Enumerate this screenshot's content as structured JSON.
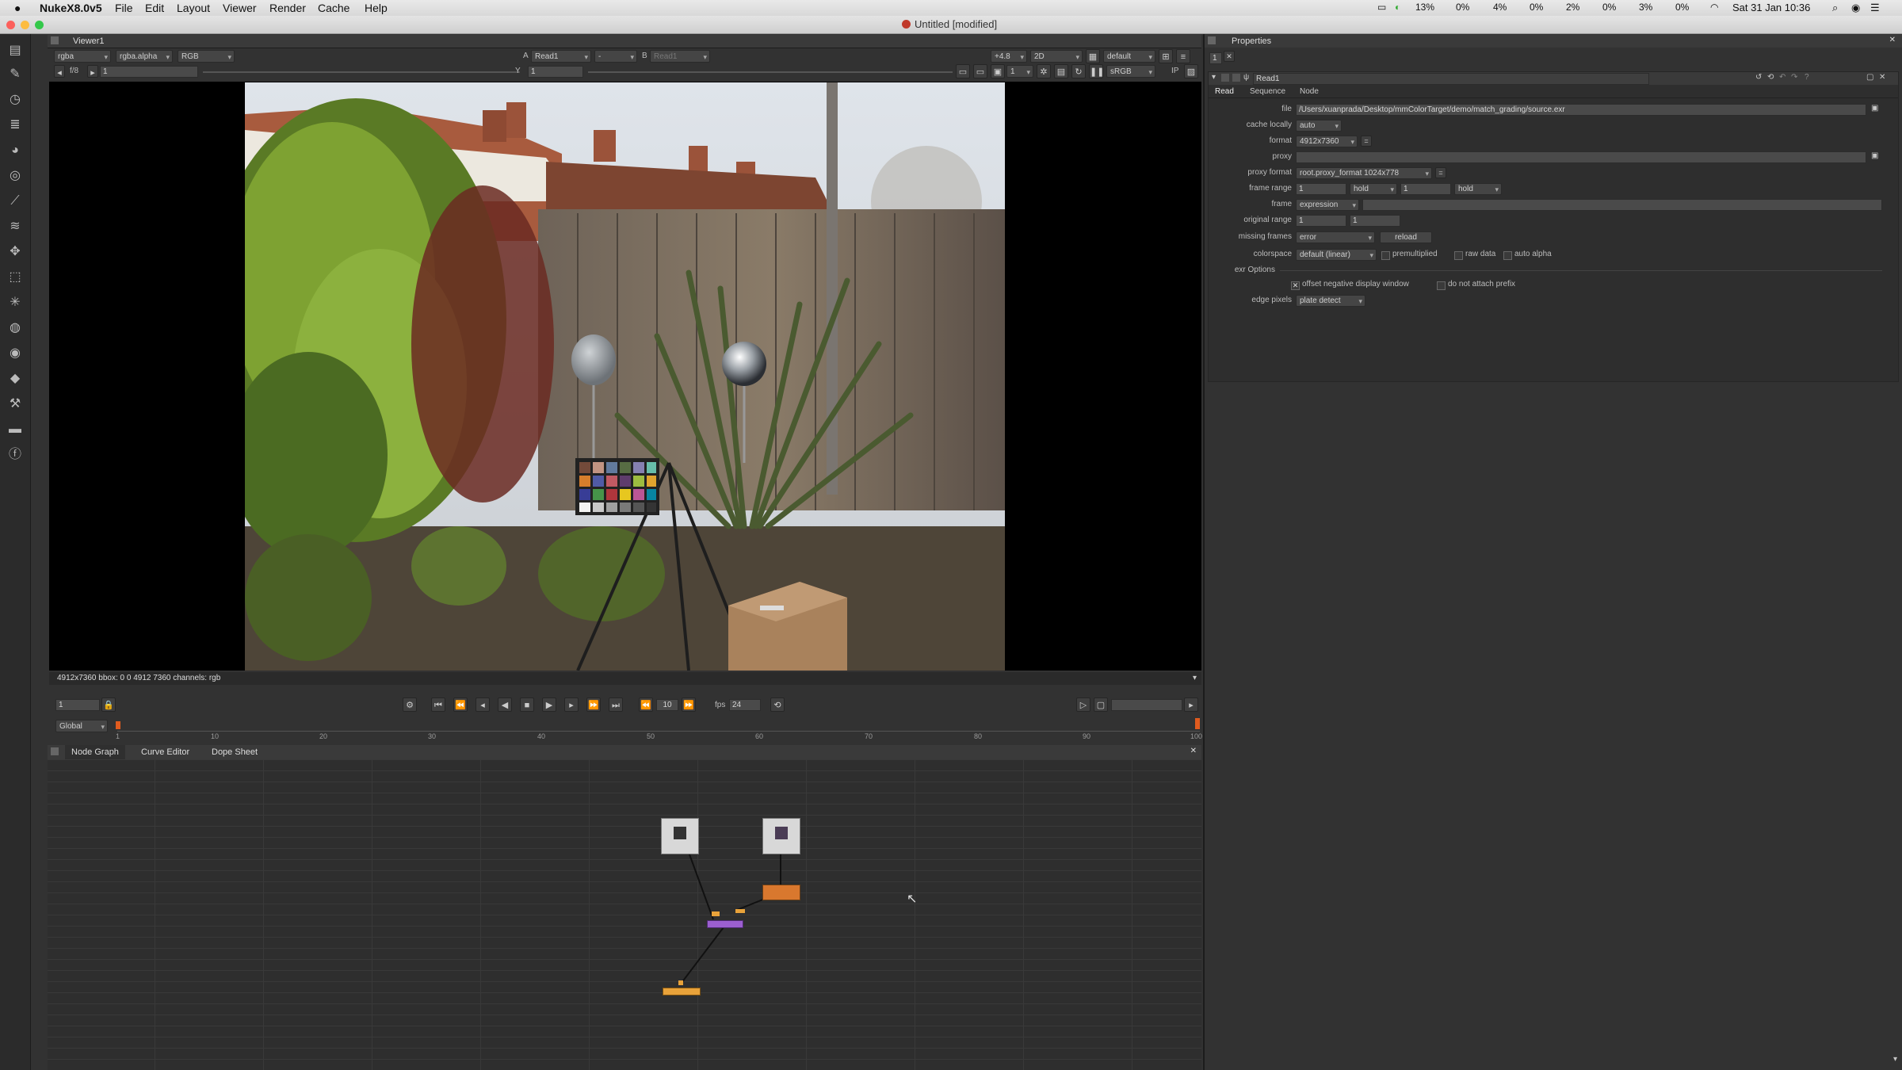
{
  "menubar": {
    "app_name": "NukeX8.0v5",
    "menus": [
      "File",
      "Edit",
      "Layout",
      "Viewer",
      "Render",
      "Cache",
      "Help"
    ],
    "status_items": [
      "13%",
      "0%",
      "4%",
      "0%",
      "2%",
      "0%",
      "3%",
      "0%"
    ],
    "clock": "Sat 31 Jan 10:36"
  },
  "window": {
    "title": "Untitled [modified]"
  },
  "viewer": {
    "tab": "Viewer1",
    "channels": "rgba",
    "alpha": "rgba.alpha",
    "display": "RGB",
    "a_label": "A",
    "a_input": "Read1",
    "op": "-",
    "b_label": "B",
    "b_input": "Read1",
    "gain": "+4.8",
    "mode": "2D",
    "lut": "default",
    "fstop": "f/8",
    "frame_field": "1",
    "y_label": "Y",
    "y_value": "1",
    "gamma": "1",
    "colorspace": "sRGB",
    "ip": "IP",
    "info": "4912x7360 bbox: 0 0 4912 7360 channels: rgb"
  },
  "timeline": {
    "frame": "1",
    "scope": "Global",
    "step": "10",
    "fps_label": "fps",
    "fps": "24",
    "ticks": [
      "1",
      "10",
      "20",
      "30",
      "40",
      "50",
      "60",
      "70",
      "80",
      "90",
      "100"
    ]
  },
  "graph": {
    "tabs": [
      "Node Graph",
      "Curve Editor",
      "Dope Sheet"
    ]
  },
  "properties": {
    "title": "Properties",
    "node_name": "Read1",
    "tabs": [
      "Read",
      "Sequence",
      "Node"
    ],
    "file_label": "file",
    "file": "/Users/xuanprada/Desktop/mmColorTarget/demo/match_grading/source.exr",
    "cache_label": "cache locally",
    "cache": "auto",
    "format_label": "format",
    "format": "4912x7360",
    "proxy_label": "proxy",
    "proxy_format_label": "proxy format",
    "proxy_format": "root.proxy_format 1024x778",
    "frame_range_label": "frame range",
    "range_start": "1",
    "range_before": "hold",
    "range_end": "1",
    "range_after": "hold",
    "frame_label": "frame",
    "frame_mode": "expression",
    "original_range_label": "original range",
    "orig_start": "1",
    "orig_end": "1",
    "missing_label": "missing frames",
    "missing": "error",
    "reload": "reload",
    "colorspace_label": "colorspace",
    "colorspace": "default (linear)",
    "premultiplied": "premultiplied",
    "raw_data": "raw data",
    "auto_alpha": "auto alpha",
    "exr_options": "exr Options",
    "offset_neg": "offset negative display window",
    "no_prefix": "do not attach prefix",
    "edge_label": "edge pixels",
    "edge": "plate detect"
  },
  "colors": {
    "bg": "#323232",
    "viewer_bg": "#000000",
    "graph_bg": "#2e2e2e",
    "node_orange": "#d9782e",
    "node_purple": "#9c5fd0",
    "node_yellow": "#e8a23a",
    "accent_red": "#d0532c"
  }
}
